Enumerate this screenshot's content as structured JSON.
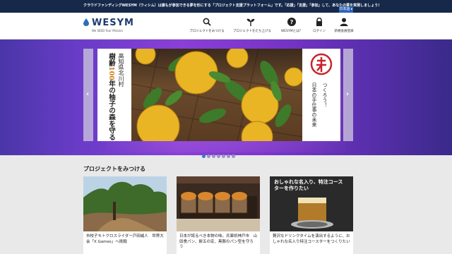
{
  "topbar": {
    "text": "クラウドファンディングWESYM（ウィシム）は誰もが参加できる夢を形にする「プロジェクト支援プラットフォーム」です。「応援」「支援」「参加」して、あなたの夢を実現しましょう！",
    "lang_button": "日本語 ▸"
  },
  "header": {
    "logo_name": "WESYM",
    "logo_tagline": "We SEED Your Mission",
    "nav": [
      {
        "label": "プロジェクトをみつける",
        "icon": "search-icon"
      },
      {
        "label": "プロジェクトをたち上げる",
        "icon": "sprout-icon"
      },
      {
        "label": "WESYMとは？",
        "icon": "question-icon"
      },
      {
        "label": "ログイン",
        "icon": "lock-icon"
      },
      {
        "label": "新規会員登録",
        "icon": "user-icon"
      }
    ]
  },
  "hero": {
    "left_line1": "高知県北川村",
    "left_line2_num": "100",
    "left_line2_pre": "樹齢",
    "left_line2_post": "年の柚子の森を守る",
    "right_line1": "つくろう！",
    "right_line2": "日本の手仕事の未来",
    "prev": "‹",
    "next": "›",
    "dot_count": 7,
    "active_dot": 0
  },
  "section": {
    "title": "プロジェクトをみつける"
  },
  "cards": [
    {
      "title": "市校子モトクロスライダー戸田誠人　世界大会「X Games」へ挑戦"
    },
    {
      "title": "日本が誇るべき本物の味。兵庫県神戸市　山田食パン、餅五の宏、黒豚のパン型を守ろう"
    },
    {
      "overlay": "おしゃれな名入り、特注コースターを作りたい",
      "title": "贅沢なドリンクタイムを演出するように、おしゃれな名入り特注コースターをつくりたい"
    }
  ],
  "colors": {
    "topbar_bg": "#16294a",
    "brand_blue": "#1d3b6e",
    "accent_blue": "#2e7bd1",
    "hero_purple": "#7a35c8"
  }
}
